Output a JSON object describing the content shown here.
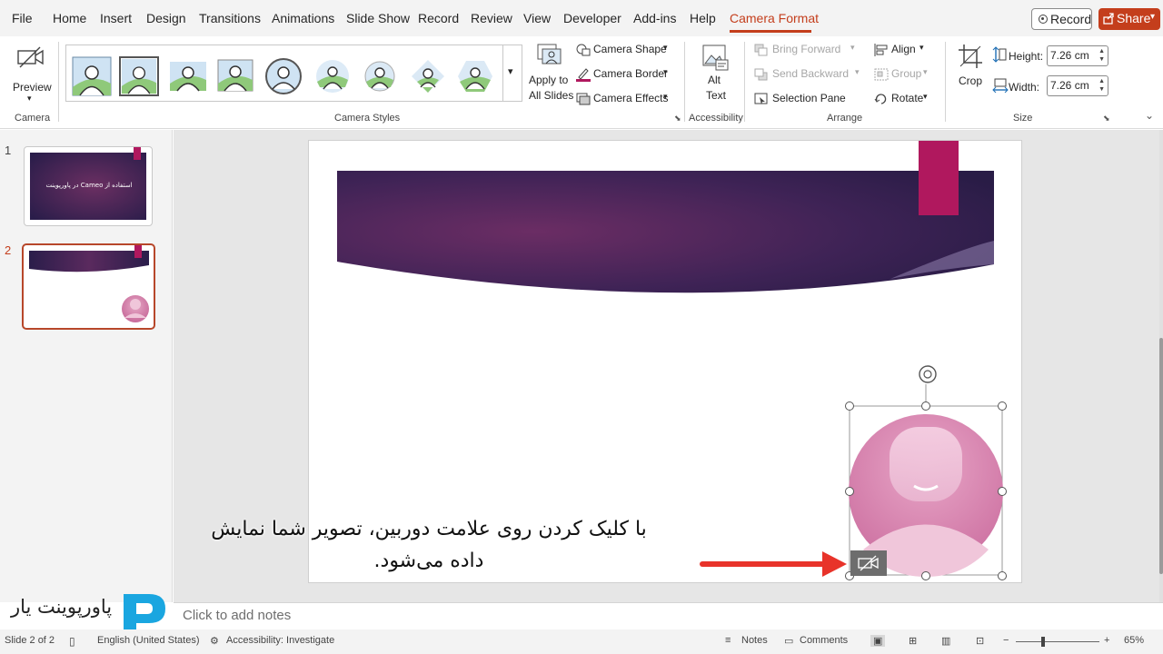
{
  "menu": {
    "tabs": [
      "File",
      "Home",
      "Insert",
      "Design",
      "Transitions",
      "Animations",
      "Slide Show",
      "Record",
      "Review",
      "View",
      "Developer",
      "Add-ins",
      "Help",
      "Camera Format"
    ],
    "active_tab": "Camera Format",
    "record_label": "Record",
    "share_label": "Share",
    "accent_color": "#c43e1c"
  },
  "ribbon": {
    "camera_group": {
      "preview_label": "Preview",
      "group_label": "Camera"
    },
    "styles_group": {
      "group_label": "Camera Styles",
      "apply_label_1": "Apply to",
      "apply_label_2": "All Slides"
    },
    "camera_shape": "Camera Shape",
    "camera_border": "Camera Border",
    "camera_effects": "Camera Effects",
    "accessibility": {
      "alt_text_1": "Alt",
      "alt_text_2": "Text",
      "group_label": "Accessibility"
    },
    "arrange": {
      "bring_forward": "Bring Forward",
      "send_backward": "Send Backward",
      "selection_pane": "Selection Pane",
      "align": "Align",
      "group": "Group",
      "rotate": "Rotate",
      "group_label": "Arrange"
    },
    "size": {
      "crop_label": "Crop",
      "height_label": "Height:",
      "height_value": "7.26 cm",
      "width_label": "Width:",
      "width_value": "7.26 cm",
      "group_label": "Size"
    }
  },
  "slides": {
    "numbers": [
      "1",
      "2"
    ],
    "thumb1_title": "استفاده از Cameo در پاورپوینت"
  },
  "caption": {
    "line1": "با کلیک کردن روی علامت دوربین، تصویر شما نمایش",
    "line2": "داده می‌شود."
  },
  "brand": {
    "name": "پاورپوینت یار"
  },
  "notes_placeholder": "Click to add notes",
  "status": {
    "slide_info": "Slide 2 of 2",
    "language": "English (United States)",
    "accessibility": "Accessibility: Investigate",
    "notes": "Notes",
    "comments": "Comments",
    "zoom": "65%"
  }
}
